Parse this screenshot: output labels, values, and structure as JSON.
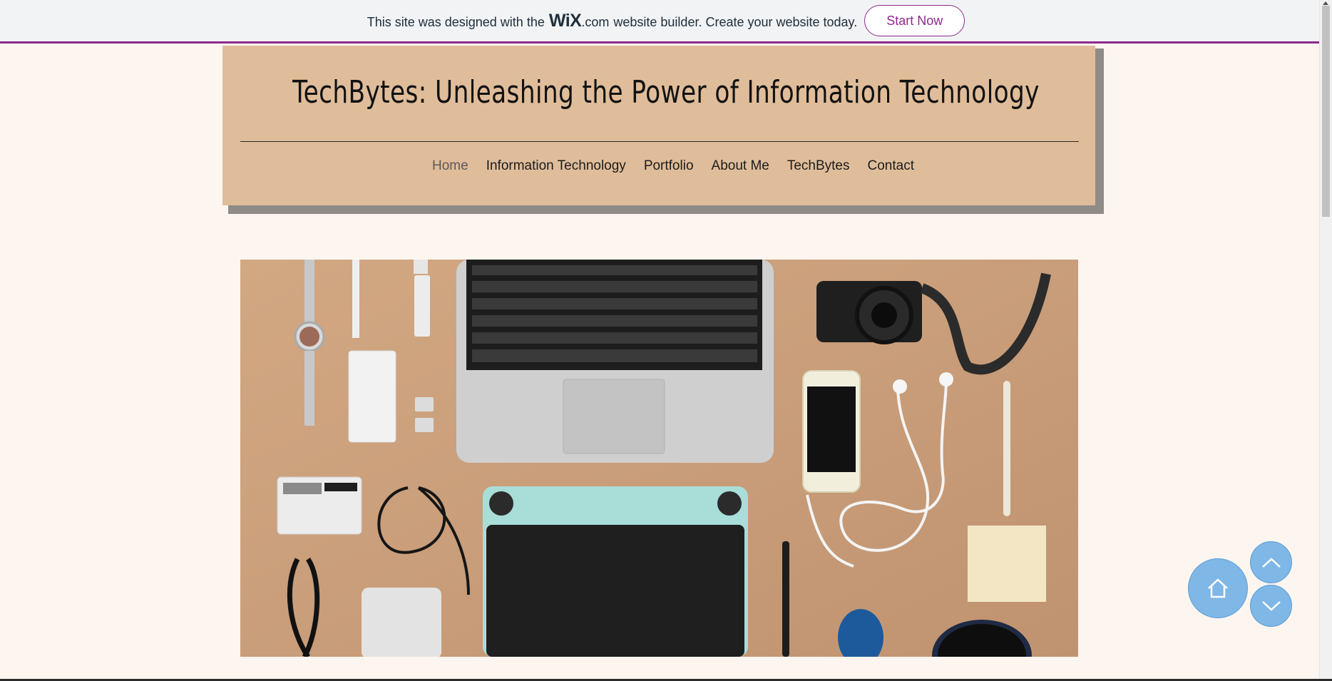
{
  "banner": {
    "text_before": "This site was designed with the",
    "logo_wix": "WiX",
    "logo_dotcom": ".com",
    "text_after": "website builder. Create your website today.",
    "button_label": "Start Now",
    "accent_color": "#8e2a8b"
  },
  "header": {
    "title": "TechBytes: Unleashing the Power of Information Technology",
    "background_color": "#e0bd9a"
  },
  "nav": {
    "items": [
      {
        "label": "Home",
        "active": true
      },
      {
        "label": "Information Technology"
      },
      {
        "label": "Portfolio"
      },
      {
        "label": "About Me"
      },
      {
        "label": "TechBytes"
      },
      {
        "label": "Contact"
      }
    ]
  },
  "hero": {
    "image_icon": "flat-lay-tech-gadgets-image"
  },
  "floating_buttons": {
    "home_icon": "home-icon",
    "up_icon": "chevron-up-icon",
    "down_icon": "chevron-down-icon",
    "color": "#7fb7e6"
  }
}
